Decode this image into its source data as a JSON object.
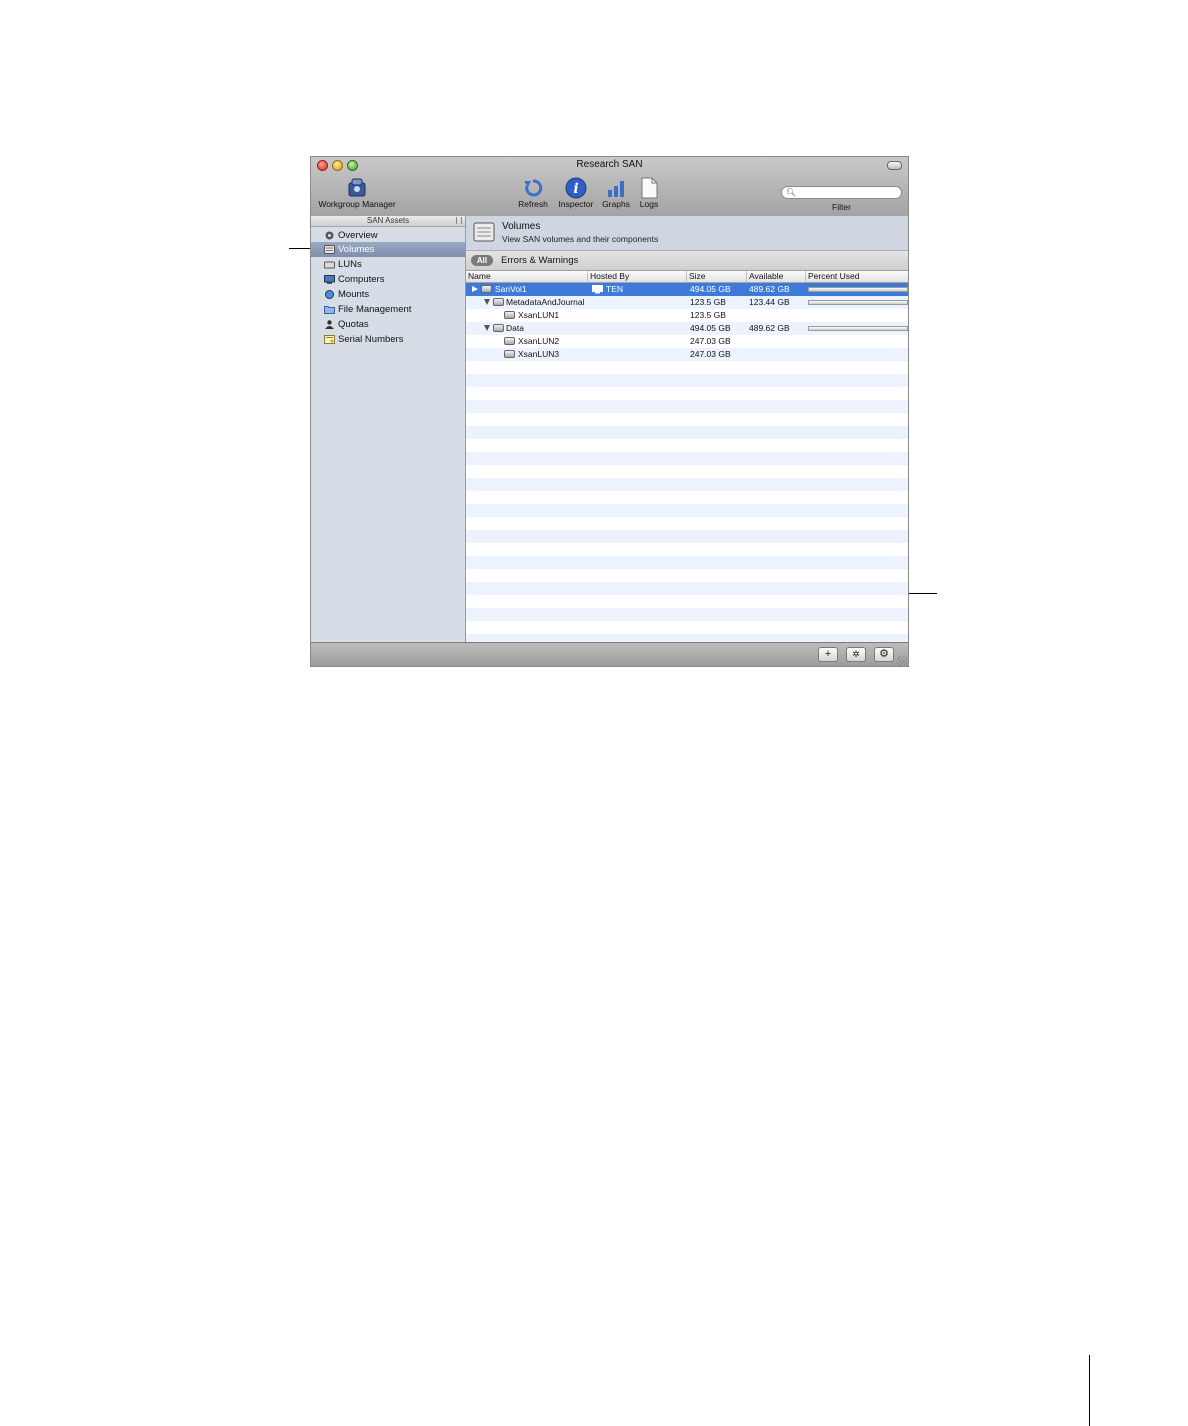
{
  "window": {
    "title": "Research SAN"
  },
  "toolbar": {
    "workgroup_manager": "Workgroup Manager",
    "refresh": "Refresh",
    "inspector": "Inspector",
    "graphs": "Graphs",
    "logs": "Logs",
    "filter_label": "Filter",
    "filter_value": ""
  },
  "sidebar": {
    "header": "SAN Assets",
    "items": [
      {
        "label": "Overview",
        "icon": "overview-icon"
      },
      {
        "label": "Volumes",
        "icon": "volume-icon",
        "selected": true
      },
      {
        "label": "LUNs",
        "icon": "lun-icon"
      },
      {
        "label": "Computers",
        "icon": "computer-icon"
      },
      {
        "label": "Mounts",
        "icon": "mount-icon"
      },
      {
        "label": "File Management",
        "icon": "folder-icon"
      },
      {
        "label": "Quotas",
        "icon": "user-icon"
      },
      {
        "label": "Serial Numbers",
        "icon": "certificate-icon"
      }
    ]
  },
  "main": {
    "title": "Volumes",
    "subtitle": "View SAN volumes and their components",
    "scope": {
      "all": "All",
      "errors": "Errors & Warnings"
    },
    "columns": [
      "Name",
      "Hosted By",
      "Size",
      "Available",
      "Percent Used"
    ],
    "rows": [
      {
        "name": "SanVol1",
        "hosted_by": "TEN",
        "size": "494.05 GB",
        "available": "489.62 GB",
        "percent_used": 0.01,
        "selected": true
      },
      {
        "name": "MetadataAndJournal",
        "hosted_by": "",
        "size": "123.5 GB",
        "available": "123.44 GB",
        "percent_used": 0.0
      },
      {
        "name": "XsanLUN1",
        "hosted_by": "",
        "size": "123.5 GB",
        "available": ""
      },
      {
        "name": "Data",
        "hosted_by": "",
        "size": "494.05 GB",
        "available": "489.62 GB",
        "percent_used": 0.01
      },
      {
        "name": "XsanLUN2",
        "hosted_by": "",
        "size": "247.03 GB",
        "available": ""
      },
      {
        "name": "XsanLUN3",
        "hosted_by": "",
        "size": "247.03 GB",
        "available": ""
      }
    ]
  },
  "bottom_bar": {
    "add": "+",
    "action": "✲",
    "gear": "⚙"
  }
}
